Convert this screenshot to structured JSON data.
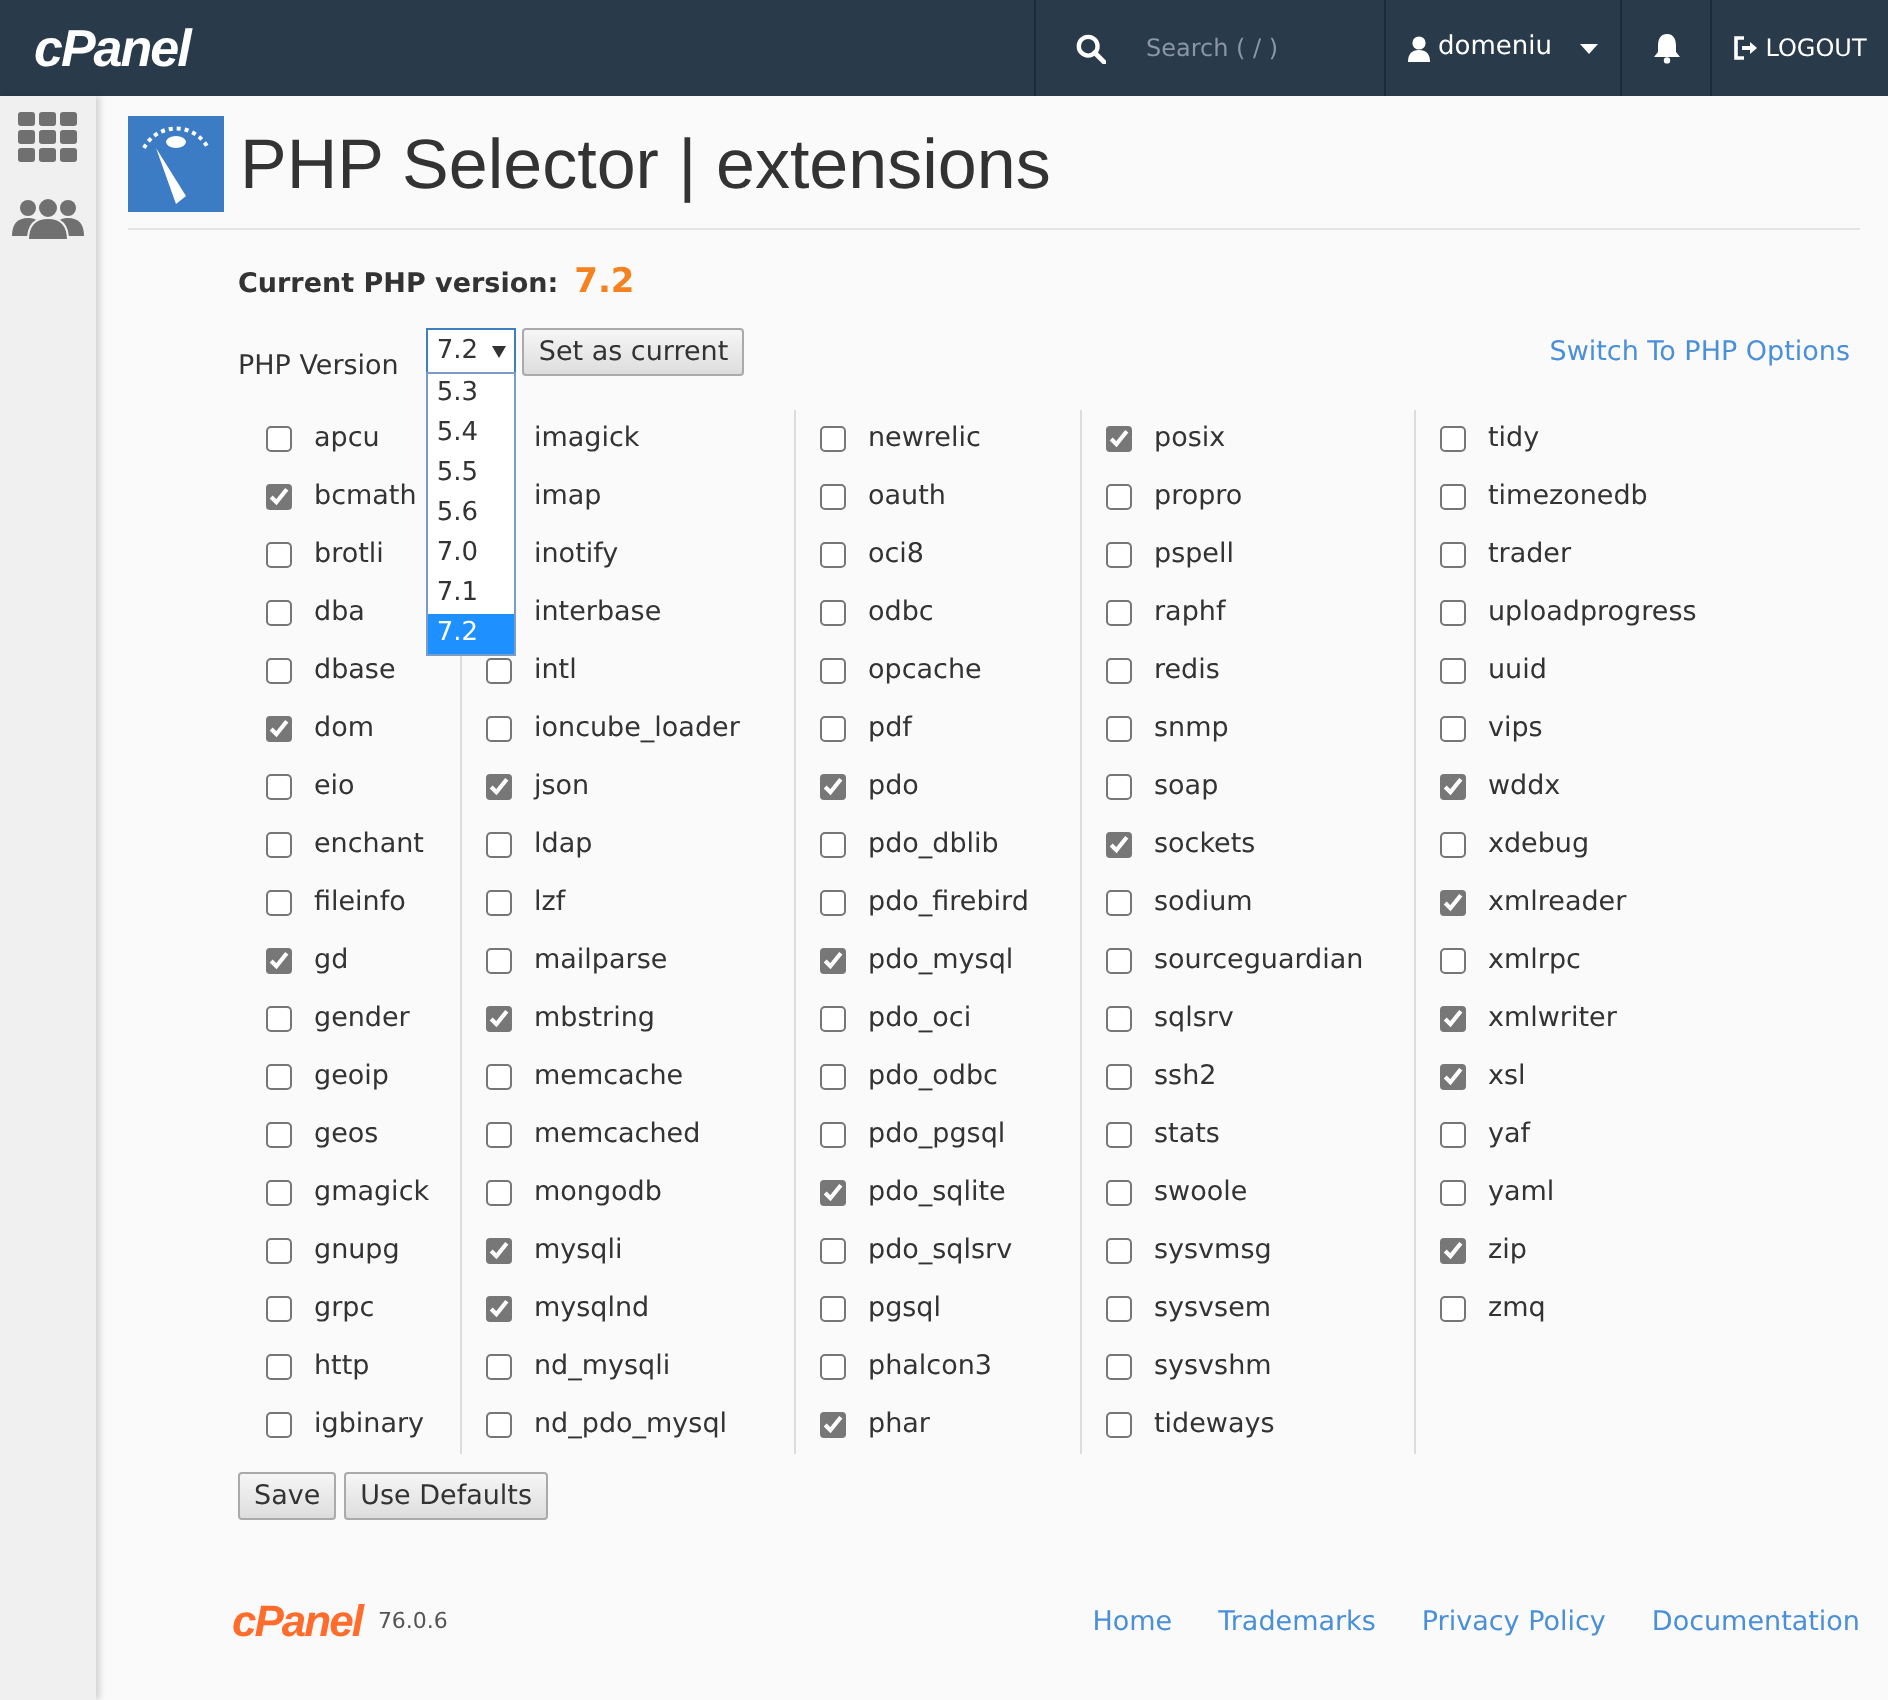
{
  "header": {
    "logo": "cPanel",
    "search": {
      "placeholder": "Search ( / )"
    },
    "user": "domeniu",
    "logout": "LOGOUT"
  },
  "page": {
    "title": "PHP Selector | extensions"
  },
  "current_version": {
    "label": "Current PHP version:",
    "value": "7.2"
  },
  "version_select": {
    "label": "PHP Version",
    "value": "7.2",
    "expanded": true,
    "options": [
      {
        "label": "5.3",
        "selected": false
      },
      {
        "label": "5.4",
        "selected": false
      },
      {
        "label": "5.5",
        "selected": false
      },
      {
        "label": "5.6",
        "selected": false
      },
      {
        "label": "7.0",
        "selected": false
      },
      {
        "label": "7.1",
        "selected": false
      },
      {
        "label": "7.2",
        "selected": true
      }
    ],
    "button": "Set as current"
  },
  "switch_link": "Switch To PHP Options",
  "extension_columns": [
    [
      {
        "name": "apcu",
        "checked": false
      },
      {
        "name": "bcmath",
        "checked": true
      },
      {
        "name": "brotli",
        "checked": false
      },
      {
        "name": "dba",
        "checked": false
      },
      {
        "name": "dbase",
        "checked": false
      },
      {
        "name": "dom",
        "checked": true
      },
      {
        "name": "eio",
        "checked": false
      },
      {
        "name": "enchant",
        "checked": false
      },
      {
        "name": "fileinfo",
        "checked": false
      },
      {
        "name": "gd",
        "checked": true
      },
      {
        "name": "gender",
        "checked": false
      },
      {
        "name": "geoip",
        "checked": false
      },
      {
        "name": "geos",
        "checked": false
      },
      {
        "name": "gmagick",
        "checked": false
      },
      {
        "name": "gnupg",
        "checked": false
      },
      {
        "name": "grpc",
        "checked": false
      },
      {
        "name": "http",
        "checked": false
      },
      {
        "name": "igbinary",
        "checked": false
      }
    ],
    [
      {
        "name": "imagick"
      },
      {
        "name": "imap"
      },
      {
        "name": "inotify"
      },
      {
        "name": "interbase"
      },
      {
        "name": "intl",
        "checked": false
      },
      {
        "name": "ioncube_loader",
        "checked": false
      },
      {
        "name": "json",
        "checked": true
      },
      {
        "name": "ldap",
        "checked": false
      },
      {
        "name": "lzf",
        "checked": false
      },
      {
        "name": "mailparse",
        "checked": false
      },
      {
        "name": "mbstring",
        "checked": true
      },
      {
        "name": "memcache",
        "checked": false
      },
      {
        "name": "memcached",
        "checked": false
      },
      {
        "name": "mongodb",
        "checked": false
      },
      {
        "name": "mysqli",
        "checked": true
      },
      {
        "name": "mysqlnd",
        "checked": true
      },
      {
        "name": "nd_mysqli",
        "checked": false
      },
      {
        "name": "nd_pdo_mysql",
        "checked": false
      }
    ],
    [
      {
        "name": "newrelic",
        "checked": false
      },
      {
        "name": "oauth",
        "checked": false
      },
      {
        "name": "oci8",
        "checked": false
      },
      {
        "name": "odbc",
        "checked": false
      },
      {
        "name": "opcache",
        "checked": false
      },
      {
        "name": "pdf",
        "checked": false
      },
      {
        "name": "pdo",
        "checked": true
      },
      {
        "name": "pdo_dblib",
        "checked": false
      },
      {
        "name": "pdo_firebird",
        "checked": false
      },
      {
        "name": "pdo_mysql",
        "checked": true
      },
      {
        "name": "pdo_oci",
        "checked": false
      },
      {
        "name": "pdo_odbc",
        "checked": false
      },
      {
        "name": "pdo_pgsql",
        "checked": false
      },
      {
        "name": "pdo_sqlite",
        "checked": true
      },
      {
        "name": "pdo_sqlsrv",
        "checked": false
      },
      {
        "name": "pgsql",
        "checked": false
      },
      {
        "name": "phalcon3",
        "checked": false
      },
      {
        "name": "phar",
        "checked": true
      }
    ],
    [
      {
        "name": "posix",
        "checked": true
      },
      {
        "name": "propro",
        "checked": false
      },
      {
        "name": "pspell",
        "checked": false
      },
      {
        "name": "raphf",
        "checked": false
      },
      {
        "name": "redis",
        "checked": false
      },
      {
        "name": "snmp",
        "checked": false
      },
      {
        "name": "soap",
        "checked": false
      },
      {
        "name": "sockets",
        "checked": true
      },
      {
        "name": "sodium",
        "checked": false
      },
      {
        "name": "sourceguardian",
        "checked": false
      },
      {
        "name": "sqlsrv",
        "checked": false
      },
      {
        "name": "ssh2",
        "checked": false
      },
      {
        "name": "stats",
        "checked": false
      },
      {
        "name": "swoole",
        "checked": false
      },
      {
        "name": "sysvmsg",
        "checked": false
      },
      {
        "name": "sysvsem",
        "checked": false
      },
      {
        "name": "sysvshm",
        "checked": false
      },
      {
        "name": "tideways",
        "checked": false
      }
    ],
    [
      {
        "name": "tidy",
        "checked": false
      },
      {
        "name": "timezonedb",
        "checked": false
      },
      {
        "name": "trader",
        "checked": false
      },
      {
        "name": "uploadprogress",
        "checked": false
      },
      {
        "name": "uuid",
        "checked": false
      },
      {
        "name": "vips",
        "checked": false
      },
      {
        "name": "wddx",
        "checked": true
      },
      {
        "name": "xdebug",
        "checked": false
      },
      {
        "name": "xmlreader",
        "checked": true
      },
      {
        "name": "xmlrpc",
        "checked": false
      },
      {
        "name": "xmlwriter",
        "checked": true
      },
      {
        "name": "xsl",
        "checked": true
      },
      {
        "name": "yaf",
        "checked": false
      },
      {
        "name": "yaml",
        "checked": false
      },
      {
        "name": "zip",
        "checked": true
      },
      {
        "name": "zmq",
        "checked": false
      }
    ]
  ],
  "buttons": [
    "Save",
    "Use Defaults"
  ],
  "footer": {
    "logo": "cPanel",
    "version": "76.0.6",
    "links": [
      "Home",
      "Trademarks",
      "Privacy Policy",
      "Documentation"
    ]
  }
}
